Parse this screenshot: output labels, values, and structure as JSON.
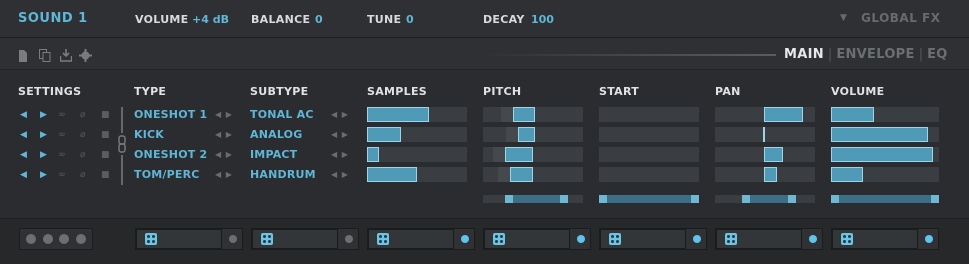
{
  "header": {
    "sound_title": "SOUND 1",
    "volume_label": "VOLUME",
    "volume_value": "+4 dB",
    "balance_label": "BALANCE",
    "balance_value": "0",
    "tune_label": "TUNE",
    "tune_value": "0",
    "decay_label": "DECAY",
    "decay_value": "100",
    "global_fx_label": "GLOBAL FX",
    "global_fx_arrow": "▼"
  },
  "tabs": {
    "main": "MAIN",
    "envelope": "ENVELOPE",
    "eq": "EQ",
    "sep": "|",
    "active": "MAIN"
  },
  "toolbar_icons": [
    "file-icon",
    "copy-icon",
    "save-icon",
    "gear-icon"
  ],
  "columns": {
    "settings": "SETTINGS",
    "type": "TYPE",
    "subtype": "SUBTYPE",
    "samples": "SAMPLES",
    "pitch": "PITCH",
    "start": "START",
    "pan": "PAN",
    "volume": "VOLUME"
  },
  "rows": [
    {
      "type": "ONESHOT 1",
      "subtype": "TONAL AC",
      "samples": 0.62,
      "pitch_from": 0.3,
      "pitch_to": 0.52,
      "start": 0.0,
      "pan_from": 0.49,
      "pan_to": 0.88,
      "volume": 0.4
    },
    {
      "type": "KICK",
      "subtype": "ANALOG",
      "samples": 0.34,
      "pitch_from": 0.35,
      "pitch_to": 0.52,
      "start": 0.0,
      "pan_from": 0.48,
      "pan_to": 0.5,
      "volume": 0.9
    },
    {
      "type": "ONESHOT 2",
      "subtype": "IMPACT",
      "samples": 0.12,
      "pitch_from": 0.22,
      "pitch_to": 0.5,
      "start": 0.0,
      "pan_from": 0.49,
      "pan_to": 0.68,
      "volume": 0.94
    },
    {
      "type": "TOM/PERC",
      "subtype": "HANDRUM",
      "samples": 0.5,
      "pitch_from": 0.27,
      "pitch_to": 0.5,
      "start": 0.0,
      "pan_from": 0.49,
      "pan_to": 0.62,
      "volume": 0.3
    }
  ],
  "settings_icons": [
    "speaker-icon",
    "play-icon",
    "link-icon",
    "mute-icon",
    "lock-icon"
  ],
  "arrows_glyph": "◀ ▶",
  "colors": {
    "accent": "#5fb6d6",
    "fill": "#4f9ab6",
    "fill_border": "#9fd3e6",
    "track": "#3a3d41",
    "bg": "#2a2c2f"
  }
}
